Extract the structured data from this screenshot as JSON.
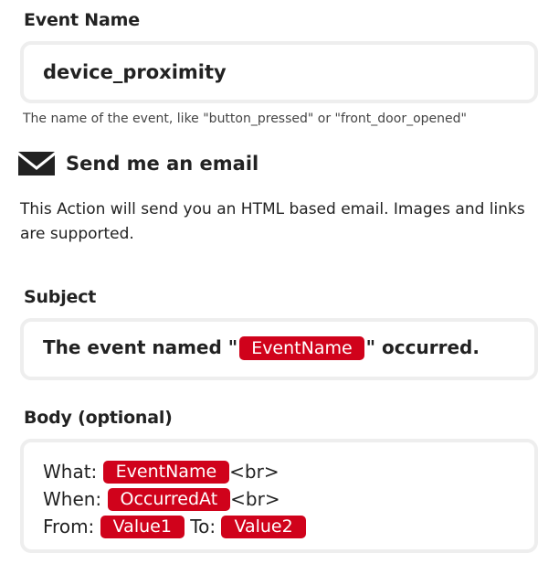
{
  "event_name": {
    "label": "Event Name",
    "value": "device_proximity",
    "hint": "The name of the event, like \"button_pressed\" or \"front_door_opened\""
  },
  "action": {
    "icon": "envelope-icon",
    "title": "Send me an email",
    "description": "This Action will send you an HTML based email. Images and links are supported."
  },
  "subject": {
    "label": "Subject",
    "prefix": "The event named \"",
    "ingredient": "EventName",
    "suffix": "\" occurred."
  },
  "body": {
    "label": "Body (optional)",
    "line1": {
      "text": "What:",
      "ingredient": "EventName",
      "after": "<br>"
    },
    "line2": {
      "text": "When:",
      "ingredient": "OccurredAt",
      "after": "<br>"
    },
    "line3": {
      "text": "From:",
      "ingredient1": "Value1",
      "middle": "To:",
      "ingredient2": "Value2"
    }
  },
  "colors": {
    "ingredient": "#d0021b",
    "field_border": "#eeeeee",
    "text": "#222222"
  }
}
